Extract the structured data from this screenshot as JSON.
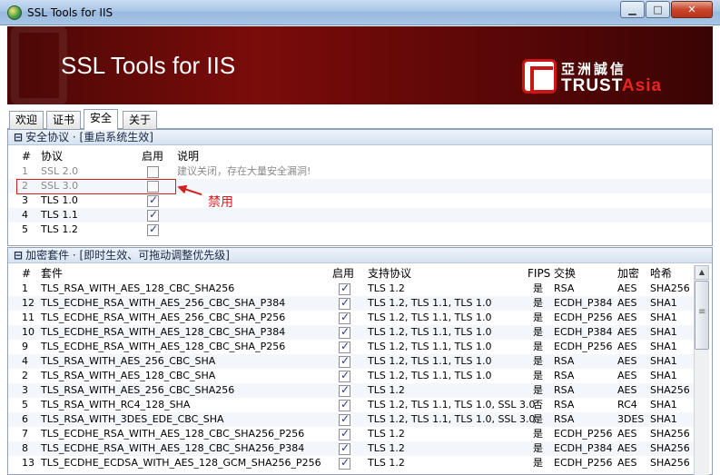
{
  "window": {
    "title": "SSL Tools for IIS",
    "min_label": "▁",
    "max_label": "□",
    "close_label": "✕"
  },
  "banner": {
    "title": "SSL Tools for IIS",
    "logo_cn": "亞洲誠信",
    "logo_en_a": "TRUST",
    "logo_en_b": "Asia",
    "brand_color": "#c81717"
  },
  "tabs": [
    {
      "label": "欢迎"
    },
    {
      "label": "证书"
    },
    {
      "label": "安全"
    },
    {
      "label": "关于"
    }
  ],
  "active_tab": "安全",
  "protocols": {
    "header": "安全协议 · [重启系统生效]",
    "toggle": "⊟",
    "columns": {
      "num": "#",
      "protocol": "协议",
      "enabled": "启用",
      "desc": "说明"
    },
    "rows": [
      {
        "num": "1",
        "name": "SSL 2.0",
        "enabled": false,
        "desc": "建议关闭，存在大量安全漏洞!",
        "disabled": true
      },
      {
        "num": "2",
        "name": "SSL 3.0",
        "enabled": false,
        "desc": "",
        "disabled": true
      },
      {
        "num": "3",
        "name": "TLS 1.0",
        "enabled": true,
        "desc": "",
        "disabled": false
      },
      {
        "num": "4",
        "name": "TLS 1.1",
        "enabled": true,
        "desc": "",
        "disabled": false
      },
      {
        "num": "5",
        "name": "TLS 1.2",
        "enabled": true,
        "desc": "",
        "disabled": false
      }
    ],
    "annotation": "禁用"
  },
  "ciphers": {
    "header": "加密套件 · [即时生效、可拖动调整优先级]",
    "toggle": "⊟",
    "columns": {
      "num": "#",
      "suite": "套件",
      "enabled": "启用",
      "protocols": "支持协议",
      "fips": "FIPS",
      "exchange": "交换",
      "encryption": "加密",
      "hash": "哈希"
    },
    "rows": [
      {
        "num": "1",
        "suite": "TLS_RSA_WITH_AES_128_CBC_SHA256",
        "enabled": true,
        "protocols": "TLS 1.2",
        "fips": "是",
        "exchange": "RSA",
        "encryption": "AES",
        "hash": "SHA256"
      },
      {
        "num": "12",
        "suite": "TLS_ECDHE_RSA_WITH_AES_256_CBC_SHA_P384",
        "enabled": true,
        "protocols": "TLS 1.2, TLS 1.1, TLS 1.0",
        "fips": "是",
        "exchange": "ECDH_P384",
        "encryption": "AES",
        "hash": "SHA1"
      },
      {
        "num": "11",
        "suite": "TLS_ECDHE_RSA_WITH_AES_256_CBC_SHA_P256",
        "enabled": true,
        "protocols": "TLS 1.2, TLS 1.1, TLS 1.0",
        "fips": "是",
        "exchange": "ECDH_P256",
        "encryption": "AES",
        "hash": "SHA1"
      },
      {
        "num": "10",
        "suite": "TLS_ECDHE_RSA_WITH_AES_128_CBC_SHA_P384",
        "enabled": true,
        "protocols": "TLS 1.2, TLS 1.1, TLS 1.0",
        "fips": "是",
        "exchange": "ECDH_P384",
        "encryption": "AES",
        "hash": "SHA1"
      },
      {
        "num": "9",
        "suite": "TLS_ECDHE_RSA_WITH_AES_128_CBC_SHA_P256",
        "enabled": true,
        "protocols": "TLS 1.2, TLS 1.1, TLS 1.0",
        "fips": "是",
        "exchange": "ECDH_P256",
        "encryption": "AES",
        "hash": "SHA1"
      },
      {
        "num": "4",
        "suite": "TLS_RSA_WITH_AES_256_CBC_SHA",
        "enabled": true,
        "protocols": "TLS 1.2, TLS 1.1, TLS 1.0",
        "fips": "是",
        "exchange": "RSA",
        "encryption": "AES",
        "hash": "SHA1"
      },
      {
        "num": "2",
        "suite": "TLS_RSA_WITH_AES_128_CBC_SHA",
        "enabled": true,
        "protocols": "TLS 1.2, TLS 1.1, TLS 1.0",
        "fips": "是",
        "exchange": "RSA",
        "encryption": "AES",
        "hash": "SHA1"
      },
      {
        "num": "3",
        "suite": "TLS_RSA_WITH_AES_256_CBC_SHA256",
        "enabled": true,
        "protocols": "TLS 1.2",
        "fips": "是",
        "exchange": "RSA",
        "encryption": "AES",
        "hash": "SHA256"
      },
      {
        "num": "5",
        "suite": "TLS_RSA_WITH_RC4_128_SHA",
        "enabled": true,
        "protocols": "TLS 1.2, TLS 1.1, TLS 1.0, SSL 3.0",
        "fips": "否",
        "exchange": "RSA",
        "encryption": "RC4",
        "hash": "SHA1"
      },
      {
        "num": "6",
        "suite": "TLS_RSA_WITH_3DES_EDE_CBC_SHA",
        "enabled": true,
        "protocols": "TLS 1.2, TLS 1.1, TLS 1.0, SSL 3.0",
        "fips": "是",
        "exchange": "RSA",
        "encryption": "3DES",
        "hash": "SHA1"
      },
      {
        "num": "7",
        "suite": "TLS_ECDHE_RSA_WITH_AES_128_CBC_SHA256_P256",
        "enabled": true,
        "protocols": "TLS 1.2",
        "fips": "是",
        "exchange": "ECDH_P256",
        "encryption": "AES",
        "hash": "SHA256"
      },
      {
        "num": "8",
        "suite": "TLS_ECDHE_RSA_WITH_AES_128_CBC_SHA256_P384",
        "enabled": true,
        "protocols": "TLS 1.2",
        "fips": "是",
        "exchange": "ECDH_P384",
        "encryption": "AES",
        "hash": "SHA256"
      },
      {
        "num": "13",
        "suite": "TLS_ECDHE_ECDSA_WITH_AES_128_GCM_SHA256_P256",
        "enabled": true,
        "protocols": "TLS 1.2",
        "fips": "是",
        "exchange": "ECDH_P256",
        "encryption": "AES",
        "hash": "SHA256"
      }
    ]
  },
  "scrollbar": {
    "up": "▲",
    "down": "▼"
  }
}
